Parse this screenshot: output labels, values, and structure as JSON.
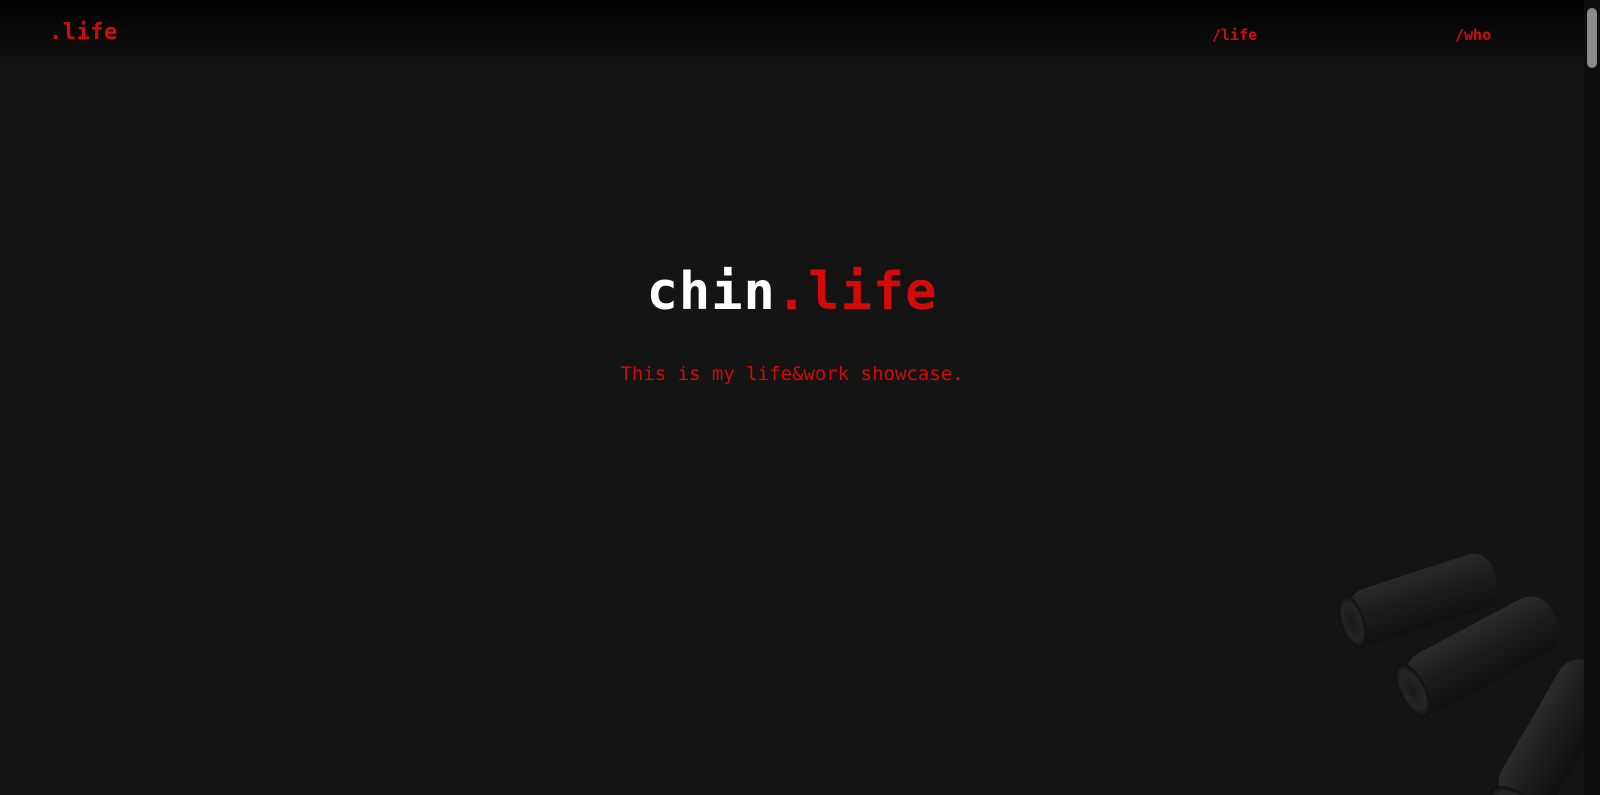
{
  "header": {
    "brand": ".life",
    "nav": [
      {
        "label": "/life"
      },
      {
        "label": "/who"
      }
    ]
  },
  "hero": {
    "title_main": "chin",
    "title_accent": ".life",
    "subtitle": "This is my life&work showcase."
  },
  "decor": {
    "icon": "bullet-casings-image"
  },
  "colors": {
    "accent": "#d10a0a",
    "background": "#141414",
    "text": "#ffffff"
  }
}
